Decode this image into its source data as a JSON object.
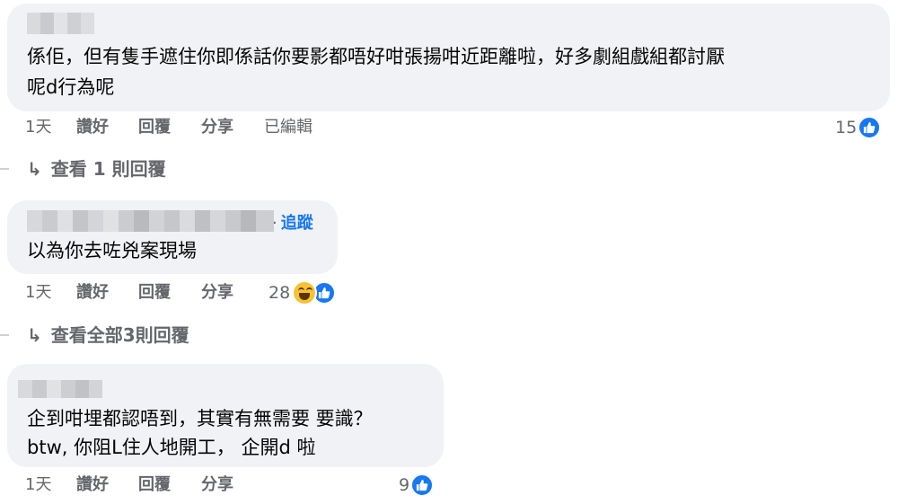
{
  "comments": [
    {
      "text_lines": [
        "係佢，但有隻手遮住你即係話你要影都唔好咁張揚咁近距離啦，好多劇組戲組都討厭",
        "呢d行為呢"
      ],
      "actions": {
        "time": "1天",
        "like": "讚好",
        "reply": "回覆",
        "share": "分享",
        "edited": "已編輯"
      },
      "reaction_count": "15",
      "reaction_types": [
        "like-icon"
      ],
      "view_replies": "查看 1 則回覆"
    },
    {
      "follow_label": "追蹤",
      "follow_separator": "·",
      "text_lines": [
        "以為你去咗兇案現場"
      ],
      "actions": {
        "time": "1天",
        "like": "讚好",
        "reply": "回覆",
        "share": "分享"
      },
      "reaction_count": "28",
      "reaction_types": [
        "haha-icon",
        "like-icon"
      ],
      "view_replies": "查看全部3則回覆"
    },
    {
      "text_lines": [
        "企到咁埋都認唔到，其實有無需要 要識？",
        "btw, 你阻L住人地開工， 企開d 啦"
      ],
      "actions": {
        "time": "1天",
        "like": "讚好",
        "reply": "回覆",
        "share": "分享"
      },
      "reaction_count": "9",
      "reaction_types": [
        "like-icon"
      ]
    }
  ],
  "colors": {
    "bubble": "#f0f2f5",
    "text": "#050505",
    "secondary": "#65676b",
    "accent": "#1877f2"
  },
  "icons": {
    "reply_arrow": "↳"
  }
}
